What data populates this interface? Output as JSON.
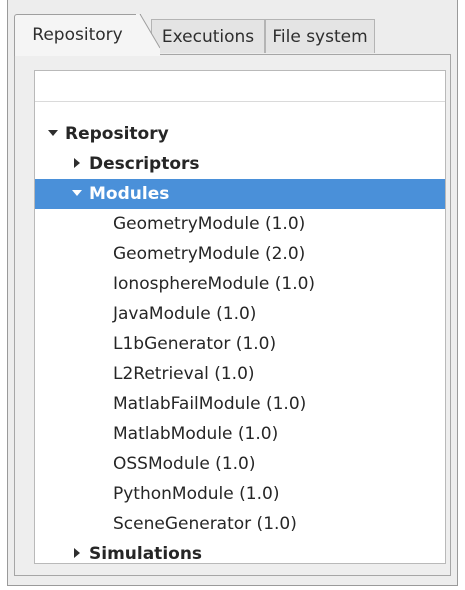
{
  "tabs": {
    "repository": "Repository",
    "executions": "Executions",
    "filesystem": "File system"
  },
  "tree": {
    "root": "Repository",
    "descriptors": "Descriptors",
    "modules": "Modules",
    "module_items": [
      "GeometryModule (1.0)",
      "GeometryModule (2.0)",
      "IonosphereModule (1.0)",
      "JavaModule (1.0)",
      "L1bGenerator (1.0)",
      "L2Retrieval (1.0)",
      "MatlabFailModule (1.0)",
      "MatlabModule (1.0)",
      "OSSModule (1.0)",
      "PythonModule (1.0)",
      "SceneGenerator (1.0)"
    ],
    "simulations": "Simulations"
  },
  "colors": {
    "selection": "#4a90d9",
    "text": "#262626"
  },
  "icons": {
    "expanded": "triangle-down-icon",
    "collapsed": "triangle-right-icon"
  }
}
